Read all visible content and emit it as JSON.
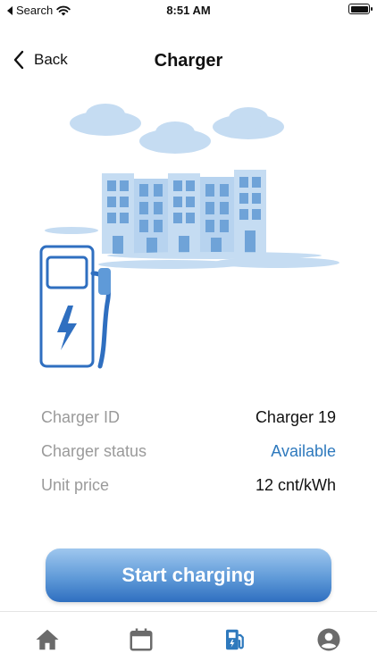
{
  "status_bar": {
    "back_app": "Search",
    "time": "8:51 AM"
  },
  "nav": {
    "back_label": "Back",
    "title": "Charger"
  },
  "charger": {
    "rows": [
      {
        "label": "Charger ID",
        "value": "Charger 19"
      },
      {
        "label": "Charger status",
        "value": "Available"
      },
      {
        "label": "Unit price",
        "value": "12 cnt/kWh"
      }
    ]
  },
  "actions": {
    "start_label": "Start charging"
  },
  "tabs": [
    {
      "icon": "home-icon",
      "active": false
    },
    {
      "icon": "calendar-icon",
      "active": false
    },
    {
      "icon": "fuel-station-icon",
      "active": true
    },
    {
      "icon": "account-icon",
      "active": false
    }
  ],
  "colors": {
    "accent": "#2e79bd",
    "inactive_tab": "#6b6b6b",
    "label": "#9a9a9a",
    "illustration_light": "#c5dcf2",
    "illustration_dark": "#2f6fc0"
  }
}
